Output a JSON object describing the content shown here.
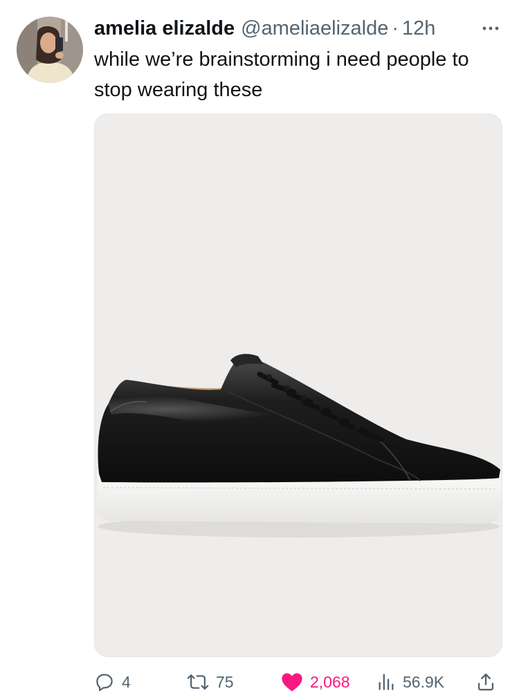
{
  "tweet": {
    "display_name": "amelia elizalde",
    "handle": "@ameliaelizalde",
    "separator": "·",
    "time": "12h",
    "text": "while we’re brainstorming i need people to stop wearing these"
  },
  "icons": {
    "more": "more-dots-icon",
    "reply": "reply-icon",
    "retweet": "retweet-icon",
    "like": "heart-filled-icon",
    "views": "views-bar-chart-icon",
    "share": "share-upload-icon"
  },
  "actions": {
    "replies": "4",
    "retweets": "75",
    "likes": "2,068",
    "views": "56.9K"
  },
  "colors": {
    "text_primary": "#0f1419",
    "text_secondary": "#536471",
    "like_active": "#f91880",
    "media_background": "#eeedeb"
  }
}
